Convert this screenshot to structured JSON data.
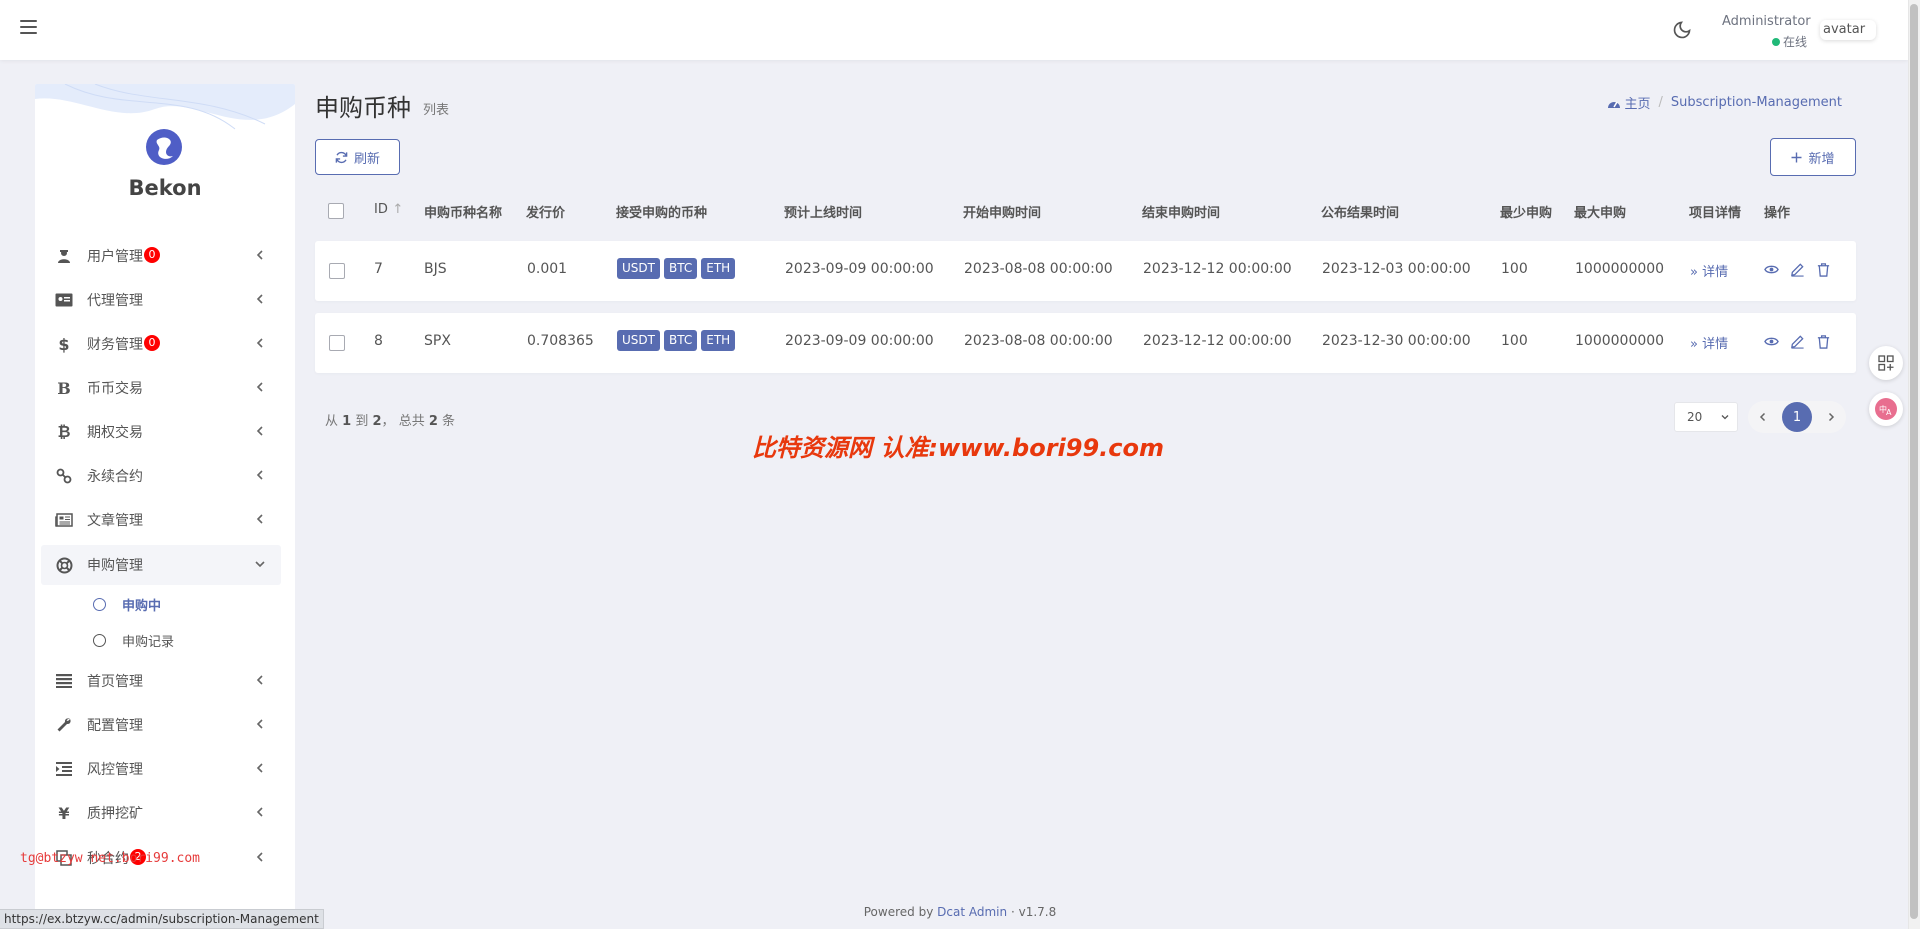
{
  "header": {
    "user_name": "Administrator",
    "user_status": "在线",
    "avatar_alt": "avatar"
  },
  "sidebar": {
    "brand": "Bekon",
    "items": [
      {
        "label": "用户管理",
        "icon": "user-secret-icon",
        "badge": "0"
      },
      {
        "label": "代理管理",
        "icon": "id-card-icon"
      },
      {
        "label": "财务管理",
        "icon": "dollar-icon",
        "badge": "0"
      },
      {
        "label": "币币交易",
        "icon": "bold-b-icon"
      },
      {
        "label": "期权交易",
        "icon": "bitcoin-icon"
      },
      {
        "label": "永续合约",
        "icon": "link-icon"
      },
      {
        "label": "文章管理",
        "icon": "newspaper-icon"
      },
      {
        "label": "申购管理",
        "icon": "life-ring-icon"
      },
      {
        "label": "首页管理",
        "icon": "bars-icon"
      },
      {
        "label": "配置管理",
        "icon": "wrench-icon"
      },
      {
        "label": "风控管理",
        "icon": "indent-icon"
      },
      {
        "label": "质押挖矿",
        "icon": "yen-icon"
      },
      {
        "label": "秒合约",
        "icon": "copy-icon",
        "badge": "2"
      }
    ],
    "sub_items": [
      {
        "label": "申购中"
      },
      {
        "label": "申购记录"
      }
    ],
    "watermark": "tg@btzyw net.bori99.com"
  },
  "content": {
    "title": "申购币种",
    "subtitle": "列表",
    "breadcrumb": {
      "home": "主页",
      "current": "Subscription-Management"
    },
    "refresh_label": "刷新",
    "new_label": "新增",
    "columns": [
      "ID",
      "申购币种名称",
      "发行价",
      "接受申购的币种",
      "预计上线时间",
      "开始申购时间",
      "结束申购时间",
      "公布结果时间",
      "最少申购",
      "最大申购",
      "项目详情",
      "操作"
    ],
    "rows": [
      {
        "id": "7",
        "name": "BJS",
        "price": "0.001",
        "coins": [
          "USDT",
          "BTC",
          "ETH"
        ],
        "listing": "2023-09-09 00:00:00",
        "start": "2023-08-08 00:00:00",
        "end": "2023-12-12 00:00:00",
        "announce": "2023-12-03 00:00:00",
        "min": "100",
        "max": "1000000000",
        "detail": "详情"
      },
      {
        "id": "8",
        "name": "SPX",
        "price": "0.708365",
        "coins": [
          "USDT",
          "BTC",
          "ETH"
        ],
        "listing": "2023-09-09 00:00:00",
        "start": "2023-08-08 00:00:00",
        "end": "2023-12-12 00:00:00",
        "announce": "2023-12-30 00:00:00",
        "min": "100",
        "max": "1000000000",
        "detail": "详情"
      }
    ],
    "pager": {
      "from_text": "从",
      "from": "1",
      "to_text": "到",
      "to": "2",
      "total_text": "总共",
      "total": "2",
      "unit": "条",
      "per_page": "20",
      "current_page": "1"
    },
    "watermark": "比特资源网 认准:www.bori99.com"
  },
  "footer": {
    "powered_by": "Powered by",
    "link": "Dcat Admin",
    "sep": "·",
    "version": "v1.7.8"
  },
  "status_url": "https://ex.btzyw.cc/admin/subscription-Management",
  "colors": {
    "accent": "#586cb1",
    "badge": "#ff0000",
    "online": "#21b978",
    "watermark": "#e8380d"
  }
}
